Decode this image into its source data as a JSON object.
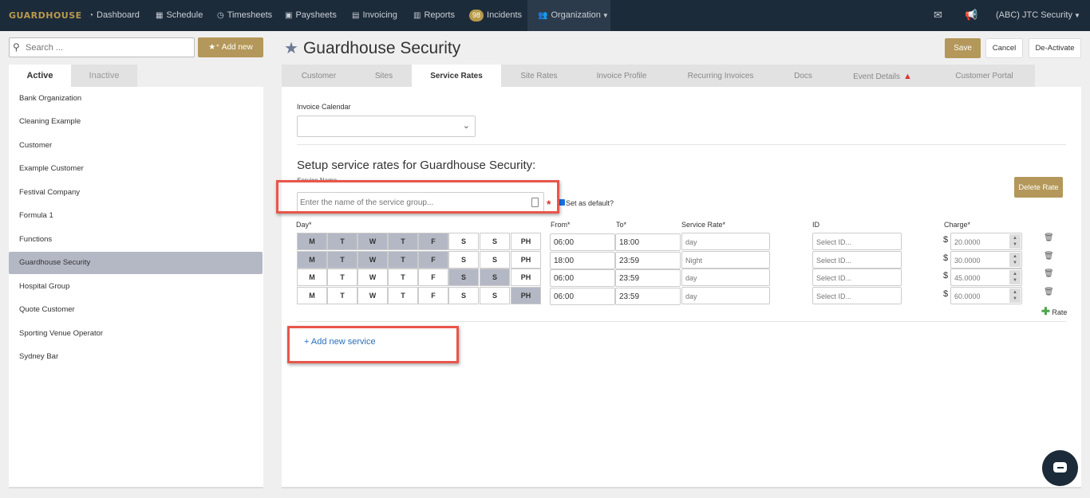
{
  "nav": {
    "logo": "GUARDHOUSE",
    "items": [
      {
        "icon": "dashboard-icon",
        "label": "Dashboard"
      },
      {
        "icon": "calendar-icon",
        "label": "Schedule"
      },
      {
        "icon": "clock-icon",
        "label": "Timesheets"
      },
      {
        "icon": "money-icon",
        "label": "Paysheets"
      },
      {
        "icon": "invoice-icon",
        "label": "Invoicing"
      },
      {
        "icon": "reports-icon",
        "label": "Reports"
      },
      {
        "icon": "incidents-badge",
        "label": "Incidents",
        "badge": "98"
      },
      {
        "icon": "users-icon",
        "label": "Organization"
      }
    ],
    "right": {
      "account": "(ABC) JTC Security"
    }
  },
  "sidebar": {
    "search_placeholder": "Search ...",
    "add_new": "Add new",
    "tabs": [
      "Active",
      "Inactive"
    ],
    "items": [
      "Bank Organization",
      "Cleaning Example",
      "Customer",
      "Example Customer",
      "Festival Company",
      "Formula 1",
      "Functions",
      "Guardhouse Security",
      "Hospital Group",
      "Quote Customer",
      "Sporting Venue Operator",
      "Sydney Bar"
    ],
    "selected": "Guardhouse Security"
  },
  "header": {
    "title": "Guardhouse Security",
    "buttons": {
      "save": "Save",
      "cancel": "Cancel",
      "deactivate": "De-Activate"
    }
  },
  "tabs": [
    "Customer",
    "Sites",
    "Service Rates",
    "Site Rates",
    "Invoice Profile",
    "Recurring Invoices",
    "Docs",
    "Event Details",
    "Customer Portal"
  ],
  "active_tab": "Service Rates",
  "form": {
    "invoice_calendar_label": "Invoice Calendar",
    "section_title": "Setup service rates for Guardhouse Security:",
    "service_name_label": "Service Name",
    "service_name_placeholder": "Enter the name of the service group...",
    "required_mark": "*",
    "set_default_label": "Set as default?",
    "delete_rate": "Delete Rate",
    "columns": {
      "day": "Day*",
      "from": "From*",
      "to": "To*",
      "service_rate": "Service Rate*",
      "id": "ID",
      "charge": "Charge*"
    },
    "day_labels": [
      "M",
      "T",
      "W",
      "T",
      "F",
      "S",
      "S",
      "PH"
    ],
    "currency": "$",
    "id_placeholder": "Select ID...",
    "rates": [
      {
        "days_on": [
          true,
          true,
          true,
          true,
          true,
          false,
          false,
          false
        ],
        "from": "06:00",
        "to": "18:00",
        "service_rate": "day",
        "charge": "20.0000"
      },
      {
        "days_on": [
          true,
          true,
          true,
          true,
          true,
          false,
          false,
          false
        ],
        "from": "18:00",
        "to": "23:59",
        "service_rate": "Night",
        "charge": "30.0000"
      },
      {
        "days_on": [
          false,
          false,
          false,
          false,
          false,
          true,
          true,
          false
        ],
        "from": "06:00",
        "to": "23:59",
        "service_rate": "day",
        "charge": "45.0000"
      },
      {
        "days_on": [
          false,
          false,
          false,
          false,
          false,
          false,
          false,
          true
        ],
        "from": "06:00",
        "to": "23:59",
        "service_rate": "day",
        "charge": "60.0000"
      }
    ],
    "add_rate": "Rate",
    "add_service": "+ Add new service"
  }
}
